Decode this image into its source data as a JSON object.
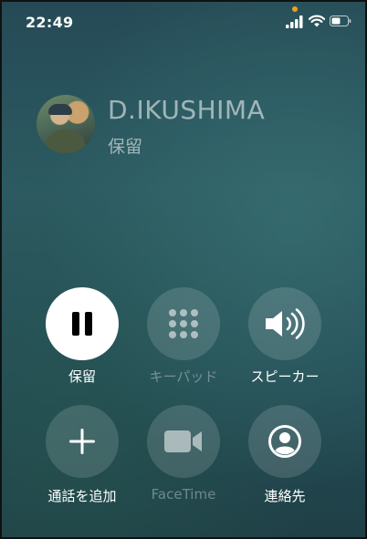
{
  "status_bar": {
    "time": "22:49"
  },
  "caller": {
    "name": "D.IKUSHIMA",
    "status": "保留"
  },
  "controls": {
    "row1": [
      {
        "label": "保留",
        "icon": "pause-icon",
        "state": "active"
      },
      {
        "label": "キーパッド",
        "icon": "keypad-icon",
        "state": "disabled"
      },
      {
        "label": "スピーカー",
        "icon": "speaker-icon",
        "state": "enabled"
      }
    ],
    "row2": [
      {
        "label": "通話を追加",
        "icon": "plus-icon",
        "state": "enabled"
      },
      {
        "label": "FaceTime",
        "icon": "video-camera-icon",
        "state": "disabled"
      },
      {
        "label": "連絡先",
        "icon": "contact-icon",
        "state": "enabled"
      }
    ]
  },
  "colors": {
    "background": "#2a5560",
    "active_button": "#ffffff",
    "status_dot": "#f0a020"
  }
}
